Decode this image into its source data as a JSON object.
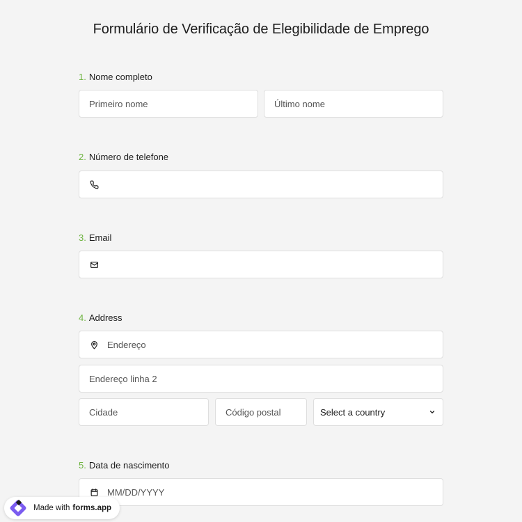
{
  "form": {
    "title": "Formulário de Verificação de Elegibilidade de Emprego"
  },
  "questions": [
    {
      "num": "1.",
      "label": "Nome completo"
    },
    {
      "num": "2.",
      "label": "Número de telefone"
    },
    {
      "num": "3.",
      "label": "Email"
    },
    {
      "num": "4.",
      "label": "Address"
    },
    {
      "num": "5.",
      "label": "Data de nascimento"
    }
  ],
  "fields": {
    "first_name_placeholder": "Primeiro nome",
    "last_name_placeholder": "Último nome",
    "phone_placeholder": "",
    "email_placeholder": "",
    "address_placeholder": "Endereço",
    "address2_placeholder": "Endereço linha 2",
    "city_placeholder": "Cidade",
    "postal_placeholder": "Código postal",
    "country_selected": "Select a country",
    "dob_placeholder": "MM/DD/YYYY"
  },
  "icons": {
    "phone": "phone-icon",
    "email": "envelope-icon",
    "address": "map-pin-icon",
    "date": "calendar-icon",
    "select": "chevron-down-icon"
  },
  "badge": {
    "text": "Made with",
    "brand": "forms.app"
  },
  "colors": {
    "accent_number": "#6db33f",
    "background": "#f4f4f4",
    "logo": "#7b5cf0"
  }
}
